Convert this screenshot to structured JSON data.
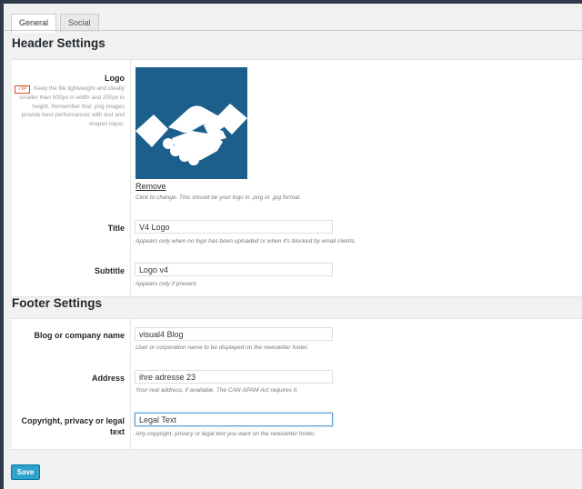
{
  "tabs": [
    {
      "label": "General",
      "active": true
    },
    {
      "label": "Social",
      "active": false
    }
  ],
  "header": {
    "title": "Header Settings",
    "logo": {
      "label": "Logo",
      "tip_tag": "TIP",
      "tip_text": "Keep the file lightweight and ideally smaller than 500px in width and 200px in height. Remember that .png images provide best performances with text and shapes logos.",
      "image_icon": "handshake-icon",
      "image_bg_color": "#1c5f8c",
      "remove_label": "Remove",
      "hint": "Click to change. This should be your logo in .png or .jpg format."
    },
    "title_field": {
      "label": "Title",
      "value": "V4 Logo",
      "hint": "Appears only when no logo has been uploaded or when it's blocked by email clients."
    },
    "subtitle_field": {
      "label": "Subtitle",
      "value": "Logo v4",
      "hint": "Appears only if present."
    }
  },
  "footer": {
    "title": "Footer Settings",
    "company": {
      "label": "Blog or company name",
      "value": "visual4 Blog",
      "hint": "User or corporation name to be displayed on the newsletter footer."
    },
    "address": {
      "label": "Address",
      "value": "ihre adresse 23",
      "hint": "Your real address, if available. The CAN-SPAM Act requires it."
    },
    "copyright": {
      "label": "Copyright, privacy or legal text",
      "value": "Legal Text",
      "hint": "Any copyright, privacy or legal text you want on the newsletter footer."
    }
  },
  "save_label": "Save",
  "colors": {
    "accent": "#2ea2cc",
    "tip": "#d54e21",
    "admin_bar": "#2f3b4a"
  }
}
